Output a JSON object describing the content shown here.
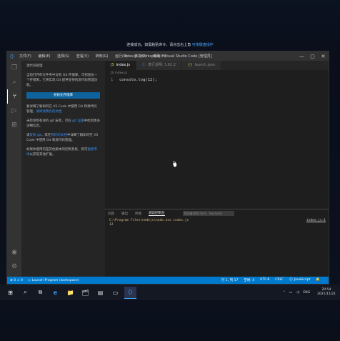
{
  "notice": {
    "text": "连接成功，如需粘贴命令，请点击右上角",
    "link": "",
    "text2": "可按键盘操作"
  },
  "titlebar": {
    "menu": [
      "文件(F)",
      "编辑(E)",
      "选择(S)",
      "查看(V)",
      "转到(G)",
      "运行(R)",
      "终端(T)",
      "帮助(H)"
    ],
    "title": "index.js - workspace - Visual Studio Code [管理员]",
    "controls": [
      "—",
      "▢",
      "✕"
    ]
  },
  "sidebar": {
    "header": "源代码管理",
    "p1": "当前打开的文件夹中没有 Git 存储库。可初始化一个存储库，它将实现 Git 提供支持的源代码管理功能。",
    "button": "初始化存储库",
    "p2a": "要详细了解如何在 VS Code 中使用 Git 和源代码管理，",
    "p2link": "请阅读我们的文档",
    "p3a": "未检测到有效的 git 安装，可在 ",
    "p3link": "git 设置",
    "p3b": "中找到更多详细信息。",
    "p4a": "请",
    "p4link1": "安装 git",
    "p4b": "，或在",
    "p4link2": "我们的文档",
    "p4c": "中详细了解如何在 VS Code 中使用 Git 和源代码管理。",
    "p5a": "如果你使用的是其他版本的控制系统，则可",
    "p5link": "搜索市场",
    "p5b": "以获取其他扩展。"
  },
  "tabs": [
    {
      "icon": "JS",
      "label": "index.js",
      "active": true
    },
    {
      "icon": "ⓘ",
      "label": "发行说明: 1.62.2",
      "active": false
    },
    {
      "icon": "{}",
      "label": "launch.json",
      "active": false
    }
  ],
  "breadcrumb": "JS index.js",
  "editor": {
    "line": "1",
    "code": "console.log(12);"
  },
  "panel": {
    "tabs": [
      "问题",
      "输出",
      "终端",
      "调试控制台"
    ],
    "filter_placeholder": "筛选器(例如 text、!exclude)",
    "cmd": "C:\\Program Files\\nodejs\\node.exe index.js",
    "output": "12",
    "link": "index.js:1"
  },
  "status": {
    "left": [
      "⊗ 0 ⚠ 0",
      "▷ Launch Program (workspace)"
    ],
    "right": [
      "行 1, 列 17",
      "空格: 4",
      "UTF-8",
      "CRLF",
      "{} JavaScript"
    ]
  },
  "taskbar": {
    "apps": [
      "⊞",
      "⌕",
      "⧉",
      "e",
      "📁",
      "🗂",
      "▤",
      "▭",
      "⟨⟩"
    ],
    "lang": "ENG",
    "time": "20:54",
    "date": "2021/11/21"
  }
}
